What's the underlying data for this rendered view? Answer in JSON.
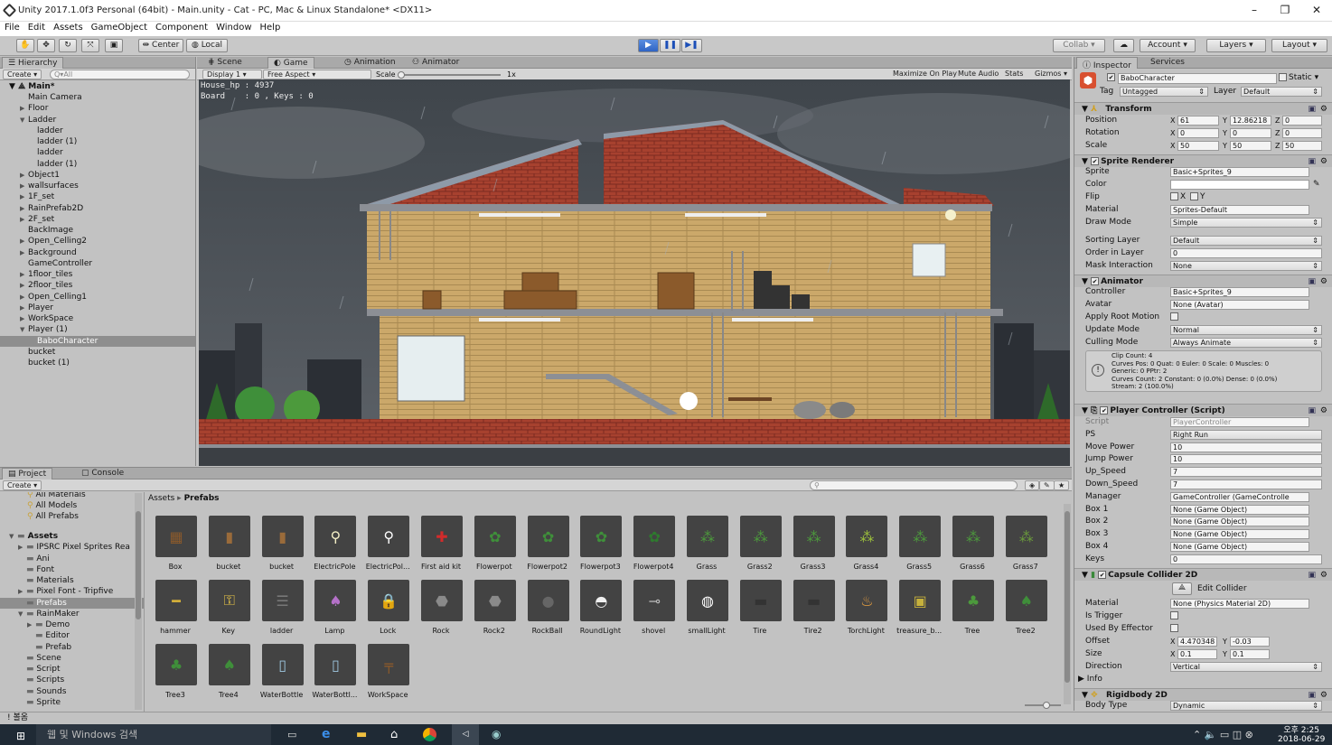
{
  "window": {
    "title": "Unity 2017.1.0f3 Personal (64bit) - Main.unity - Cat - PC, Mac & Linux Standalone* <DX11>",
    "controls": [
      "–",
      "❐",
      "✕"
    ]
  },
  "menu": [
    "File",
    "Edit",
    "Assets",
    "GameObject",
    "Component",
    "Window",
    "Help"
  ],
  "toolbar": {
    "pivot": "Center",
    "space": "Local",
    "collab": "Collab ▾",
    "account": "Account",
    "layers": "Layers",
    "layout": "Layout"
  },
  "hierarchy": {
    "tab": "Hierarchy",
    "create": "Create",
    "search_placeholder": "Q▾All",
    "scene": "Main*",
    "items": [
      {
        "label": "Main Camera",
        "depth": 1,
        "arrow": ""
      },
      {
        "label": "Floor",
        "depth": 1,
        "arrow": "▶"
      },
      {
        "label": "Ladder",
        "depth": 1,
        "arrow": "▼"
      },
      {
        "label": "ladder",
        "depth": 2,
        "arrow": ""
      },
      {
        "label": "ladder (1)",
        "depth": 2,
        "arrow": ""
      },
      {
        "label": "ladder",
        "depth": 2,
        "arrow": ""
      },
      {
        "label": "ladder (1)",
        "depth": 2,
        "arrow": ""
      },
      {
        "label": "Object1",
        "depth": 1,
        "arrow": "▶"
      },
      {
        "label": "wallsurfaces",
        "depth": 1,
        "arrow": "▶"
      },
      {
        "label": "1F_set",
        "depth": 1,
        "arrow": "▶"
      },
      {
        "label": "RainPrefab2D",
        "depth": 1,
        "arrow": "▶"
      },
      {
        "label": "2F_set",
        "depth": 1,
        "arrow": "▶"
      },
      {
        "label": "BackImage",
        "depth": 1,
        "arrow": ""
      },
      {
        "label": "Open_Celling2",
        "depth": 1,
        "arrow": "▶"
      },
      {
        "label": "Background",
        "depth": 1,
        "arrow": "▶"
      },
      {
        "label": "GameController",
        "depth": 1,
        "arrow": ""
      },
      {
        "label": "1floor_tiles",
        "depth": 1,
        "arrow": "▶"
      },
      {
        "label": "2floor_tiles",
        "depth": 1,
        "arrow": "▶"
      },
      {
        "label": "Open_Celling1",
        "depth": 1,
        "arrow": "▶"
      },
      {
        "label": "Player",
        "depth": 1,
        "arrow": "▶"
      },
      {
        "label": "WorkSpace",
        "depth": 1,
        "arrow": "▶"
      },
      {
        "label": "Player (1)",
        "depth": 1,
        "arrow": "▼"
      },
      {
        "label": "BaboCharacter",
        "depth": 2,
        "arrow": "",
        "selected": true
      },
      {
        "label": "bucket",
        "depth": 1,
        "arrow": ""
      },
      {
        "label": "bucket (1)",
        "depth": 1,
        "arrow": ""
      }
    ]
  },
  "center_tabs": [
    "Scene",
    "Game",
    "Animation",
    "Animator"
  ],
  "game_bar": {
    "display": "Display 1",
    "aspect": "Free Aspect",
    "scale_label": "Scale",
    "scale_value": "1x",
    "buttons": [
      "Maximize On Play",
      "Mute Audio",
      "Stats",
      "Gizmos ▾"
    ]
  },
  "hud": {
    "line1": "House_hp : 4937",
    "line2": "Board    : 0 , Keys : 0"
  },
  "project": {
    "tabs": [
      "Project",
      "Console"
    ],
    "create": "Create",
    "breadcrumb_root": "Assets",
    "breadcrumb_sep": "▸",
    "breadcrumb_leaf": "Prefabs",
    "favorites": [
      "All Materials",
      "All Models",
      "All Prefabs"
    ],
    "folders": [
      {
        "label": "Assets",
        "depth": 0,
        "arrow": "▼",
        "bold": true
      },
      {
        "label": "IPSRC Pixel Sprites Rea",
        "depth": 1,
        "arrow": "▶"
      },
      {
        "label": "Ani",
        "depth": 1,
        "arrow": ""
      },
      {
        "label": "Font",
        "depth": 1,
        "arrow": ""
      },
      {
        "label": "Materials",
        "depth": 1,
        "arrow": ""
      },
      {
        "label": "Pixel Font - Tripfive",
        "depth": 1,
        "arrow": "▶"
      },
      {
        "label": "Prefabs",
        "depth": 1,
        "arrow": "",
        "selected": true
      },
      {
        "label": "RainMaker",
        "depth": 1,
        "arrow": "▼"
      },
      {
        "label": "Demo",
        "depth": 2,
        "arrow": "▶"
      },
      {
        "label": "Editor",
        "depth": 2,
        "arrow": ""
      },
      {
        "label": "Prefab",
        "depth": 2,
        "arrow": ""
      },
      {
        "label": "Scene",
        "depth": 1,
        "arrow": ""
      },
      {
        "label": "Script",
        "depth": 1,
        "arrow": ""
      },
      {
        "label": "Scripts",
        "depth": 1,
        "arrow": ""
      },
      {
        "label": "Sounds",
        "depth": 1,
        "arrow": ""
      },
      {
        "label": "Sprite",
        "depth": 1,
        "arrow": ""
      }
    ],
    "assets": [
      {
        "label": "Box",
        "icon": "▦",
        "color": "#8b5a2b"
      },
      {
        "label": "bucket",
        "icon": "▮",
        "color": "#9a6b3a"
      },
      {
        "label": "bucket",
        "icon": "▮",
        "color": "#9a6b3a"
      },
      {
        "label": "ElectricPole",
        "icon": "⚲",
        "color": "#f4efc6"
      },
      {
        "label": "ElectricPol...",
        "icon": "⚲",
        "color": "#ffffff"
      },
      {
        "label": "First aid kit",
        "icon": "✚",
        "color": "#d12b2b"
      },
      {
        "label": "Flowerpot",
        "icon": "✿",
        "color": "#3f8f3a"
      },
      {
        "label": "Flowerpot2",
        "icon": "✿",
        "color": "#3f8f3a"
      },
      {
        "label": "Flowerpot3",
        "icon": "✿",
        "color": "#3f8f3a"
      },
      {
        "label": "Flowerpot4",
        "icon": "✿",
        "color": "#2e7a2e"
      },
      {
        "label": "Grass",
        "icon": "⁂",
        "color": "#4c9a3c"
      },
      {
        "label": "Grass2",
        "icon": "⁂",
        "color": "#4c9a3c"
      },
      {
        "label": "Grass3",
        "icon": "⁂",
        "color": "#4c9a3c"
      },
      {
        "label": "Grass4",
        "icon": "⁂",
        "color": "#9bbf3c"
      },
      {
        "label": "Grass5",
        "icon": "⁂",
        "color": "#4c9a3c"
      },
      {
        "label": "Grass6",
        "icon": "⁂",
        "color": "#4c9a3c"
      },
      {
        "label": "Grass7",
        "icon": "⁂",
        "color": "#6a9a3c"
      },
      {
        "label": "hammer",
        "icon": "━",
        "color": "#d4b03a"
      },
      {
        "label": "Key",
        "icon": "⚿",
        "color": "#e8c547"
      },
      {
        "label": "ladder",
        "icon": "☰",
        "color": "#777777"
      },
      {
        "label": "Lamp",
        "icon": "♠",
        "color": "#b571c9"
      },
      {
        "label": "Lock",
        "icon": "🔒",
        "color": "#e3c02a"
      },
      {
        "label": "Rock",
        "icon": "⬣",
        "color": "#8a8a8a"
      },
      {
        "label": "Rock2",
        "icon": "⬣",
        "color": "#8a8a8a"
      },
      {
        "label": "RockBall",
        "icon": "●",
        "color": "#666666"
      },
      {
        "label": "RoundLight",
        "icon": "◓",
        "color": "#f0f0f0"
      },
      {
        "label": "shovel",
        "icon": "⊸",
        "color": "#bbbbbb"
      },
      {
        "label": "smallLight",
        "icon": "◍",
        "color": "#ffffff"
      },
      {
        "label": "Tire",
        "icon": "▬",
        "color": "#333333"
      },
      {
        "label": "Tire2",
        "icon": "▬",
        "color": "#333333"
      },
      {
        "label": "TorchLight",
        "icon": "♨",
        "color": "#e8a040"
      },
      {
        "label": "treasure_b...",
        "icon": "▣",
        "color": "#c6b13c"
      },
      {
        "label": "Tree",
        "icon": "♣",
        "color": "#4c9a3c"
      },
      {
        "label": "Tree2",
        "icon": "♠",
        "color": "#3f8f3a"
      },
      {
        "label": "Tree3",
        "icon": "♣",
        "color": "#3f8f3a"
      },
      {
        "label": "Tree4",
        "icon": "♠",
        "color": "#3f8f3a"
      },
      {
        "label": "WaterBottle",
        "icon": "▯",
        "color": "#9ec7e0"
      },
      {
        "label": "WaterBottl...",
        "icon": "▯",
        "color": "#9ec7e0"
      },
      {
        "label": "WorkSpace",
        "icon": "╤",
        "color": "#8b5a2b"
      }
    ]
  },
  "status": "! 볼옴",
  "inspector": {
    "tabs": [
      "Inspector",
      "Services"
    ],
    "object_name": "BaboCharacter",
    "static_label": "Static ▾",
    "tag_label": "Tag",
    "tag": "Untagged",
    "layer_label": "Layer",
    "layer": "Default",
    "transform": {
      "title": "Transform",
      "rows": [
        {
          "label": "Position",
          "x": "61",
          "y": "12.86218",
          "z": "0"
        },
        {
          "label": "Rotation",
          "x": "0",
          "y": "0",
          "z": "0"
        },
        {
          "label": "Scale",
          "x": "50",
          "y": "50",
          "z": "50"
        }
      ]
    },
    "sprite_renderer": {
      "title": "Sprite Renderer",
      "sprite_label": "Sprite",
      "sprite": "Basic+Sprites_9",
      "color_label": "Color",
      "flip_label": "Flip",
      "flip_x": "X",
      "flip_y": "Y",
      "material_label": "Material",
      "material": "Sprites-Default",
      "drawmode_label": "Draw Mode",
      "drawmode": "Simple",
      "sortinglayer_label": "Sorting Layer",
      "sortinglayer": "Default",
      "order_label": "Order in Layer",
      "order": "0",
      "mask_label": "Mask Interaction",
      "mask": "None"
    },
    "animator": {
      "title": "Animator",
      "controller_label": "Controller",
      "controller": "Basic+Sprites_9",
      "avatar_label": "Avatar",
      "avatar": "None (Avatar)",
      "rootmotion_label": "Apply Root Motion",
      "update_label": "Update Mode",
      "update": "Normal",
      "culling_label": "Culling Mode",
      "culling": "Always Animate",
      "info": [
        "Clip Count: 4",
        "Curves Pos: 0 Quat: 0 Euler: 0 Scale: 0 Muscles: 0",
        "Generic: 0 PPtr: 2",
        "Curves Count: 2 Constant: 0 (0.0%) Dense: 0 (0.0%)",
        "Stream: 2 (100.0%)"
      ]
    },
    "player_controller": {
      "title": "Player Controller (Script)",
      "rows": [
        {
          "label": "Script",
          "value": "PlayerController"
        },
        {
          "label": "PS",
          "value": "Right Run"
        },
        {
          "label": "Move Power",
          "value": "10"
        },
        {
          "label": "Jump Power",
          "value": "10"
        },
        {
          "label": "Up_Speed",
          "value": "7"
        },
        {
          "label": "Down_Speed",
          "value": "7"
        },
        {
          "label": "Manager",
          "value": "GameController (GameControlle"
        },
        {
          "label": "Box 1",
          "value": "None (Game Object)"
        },
        {
          "label": "Box 2",
          "value": "None (Game Object)"
        },
        {
          "label": "Box 3",
          "value": "None (Game Object)"
        },
        {
          "label": "Box 4",
          "value": "None (Game Object)"
        },
        {
          "label": "Keys",
          "value": "0"
        }
      ]
    },
    "capsule": {
      "title": "Capsule Collider 2D",
      "edit_collider": "Edit Collider",
      "material_label": "Material",
      "material": "None (Physics Material 2D)",
      "trigger_label": "Is Trigger",
      "effector_label": "Used By Effector",
      "offset_label": "Offset",
      "offset_x": "4.470348",
      "offset_y": "-0.03",
      "size_label": "Size",
      "size_x": "0.1",
      "size_y": "0.1",
      "direction_label": "Direction",
      "direction": "Vertical",
      "info_label": "Info"
    },
    "rigidbody": {
      "title": "Rigidbody 2D",
      "bodytype_label": "Body Type",
      "bodytype": "Dynamic"
    }
  },
  "taskbar": {
    "search": "웹 및 Windows 검색",
    "time": "오후 2:25",
    "date": "2018-06-29"
  },
  "colors": {
    "accent": "#3a6fd8",
    "brick": "#9a3a2e",
    "wall": "#c9a86a",
    "sky": "#4a5057"
  }
}
